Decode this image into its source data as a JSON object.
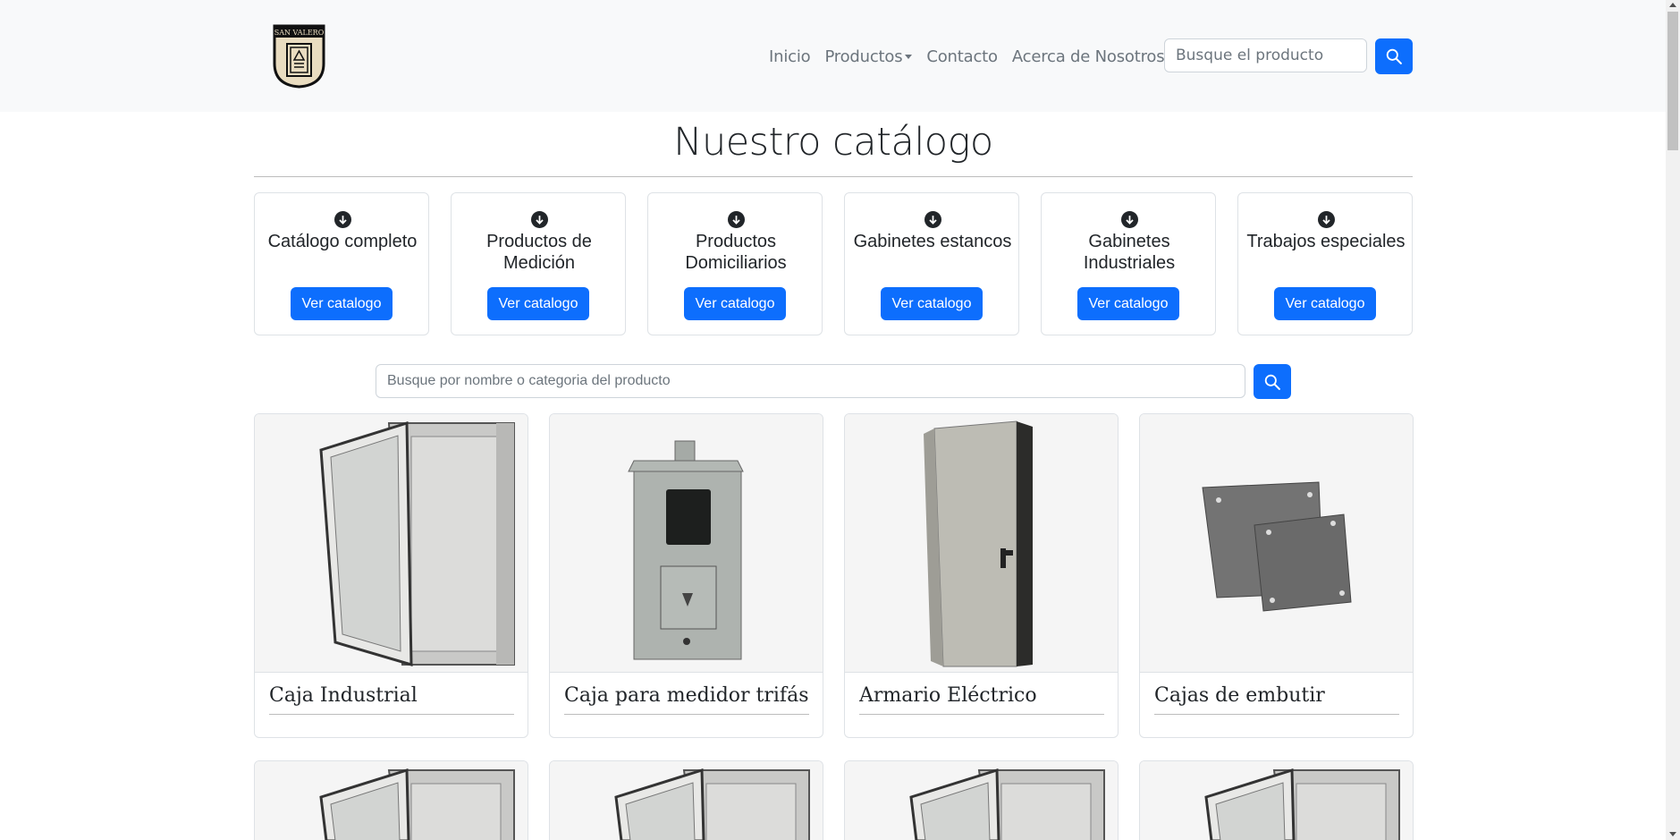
{
  "brand": {
    "logo_text": "SAN VALERO"
  },
  "nav": {
    "items": [
      {
        "label": "Inicio",
        "dropdown": false
      },
      {
        "label": "Productos",
        "dropdown": true
      },
      {
        "label": "Contacto",
        "dropdown": false
      },
      {
        "label": "Acerca de Nosotros",
        "dropdown": true
      }
    ],
    "search_placeholder": "Busque el producto",
    "search_icon": "search-icon"
  },
  "main": {
    "title": "Nuestro catálogo",
    "search_placeholder": "Busque por nombre o categoria del producto",
    "search_icon": "search-icon"
  },
  "categories": [
    {
      "title": "Catálogo completo",
      "button": "Ver catalogo",
      "icon": "arrow-down-circle-icon"
    },
    {
      "title": "Productos de Medición",
      "button": "Ver catalogo",
      "icon": "arrow-down-circle-icon"
    },
    {
      "title": "Productos Domiciliarios",
      "button": "Ver catalogo",
      "icon": "arrow-down-circle-icon"
    },
    {
      "title": "Gabinetes estancos",
      "button": "Ver catalogo",
      "icon": "arrow-down-circle-icon"
    },
    {
      "title": "Gabinetes Industriales",
      "button": "Ver catalogo",
      "icon": "arrow-down-circle-icon"
    },
    {
      "title": "Trabajos especiales",
      "button": "Ver catalogo",
      "icon": "arrow-down-circle-icon"
    }
  ],
  "products": [
    {
      "name": "Caja Industrial",
      "image": "open-enclosure"
    },
    {
      "name": "Caja para medidor trifásico",
      "image": "meter-box"
    },
    {
      "name": "Armario Eléctrico",
      "image": "cabinet"
    },
    {
      "name": "Cajas de embutir",
      "image": "flush-boxes"
    },
    {
      "name": "",
      "image": "open-enclosure"
    },
    {
      "name": "",
      "image": "open-enclosure"
    },
    {
      "name": "",
      "image": "open-enclosure"
    },
    {
      "name": "",
      "image": "open-enclosure"
    }
  ],
  "colors": {
    "primary": "#0d6efd",
    "navbar_bg": "#f8f9fa",
    "text": "#212529",
    "muted": "#6c757d"
  }
}
